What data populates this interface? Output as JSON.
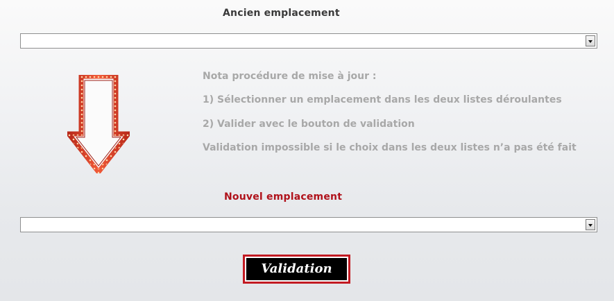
{
  "old_location": {
    "label": "Ancien emplacement",
    "selected_value": ""
  },
  "new_location": {
    "label": "Nouvel emplacement",
    "selected_value": ""
  },
  "note": {
    "title": "Nota procédure de mise à jour :",
    "step1": "1) Sélectionner un emplacement dans les deux listes déroulantes",
    "step2": "2) Valider avec le bouton de validation",
    "warning": "Validation impossible si le choix dans les deux listes n’a pas été fait"
  },
  "validate_button": {
    "label": "Validation"
  },
  "colors": {
    "new_location_label": "#b0121b",
    "note_text": "#a8a8a8",
    "button_border": "#c21a22",
    "arrow": "#d93a22"
  },
  "icons": {
    "arrow": "down-arrow-icon",
    "dropdown": "chevron-down-icon"
  }
}
